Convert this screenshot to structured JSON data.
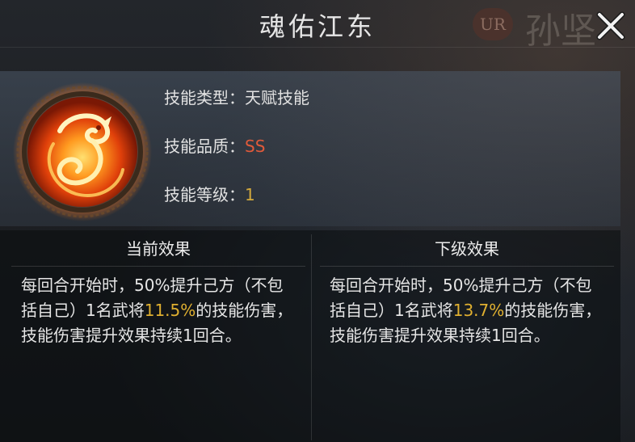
{
  "background": {
    "badge": "UR",
    "name": "孙坚"
  },
  "header": {
    "title": "魂佑江东"
  },
  "skill": {
    "icon": "dragon-emblem-icon",
    "type_label": "技能类型：",
    "type_value": "天赋技能",
    "quality_label": "技能品质：",
    "quality_value": "SS",
    "level_label": "技能等级：",
    "level_value": "1"
  },
  "current_effect": {
    "header": "当前效果",
    "text_before": "每回合开始时，50%提升己方（不包括自己）1名武将",
    "value": "11.5%",
    "text_after": "的技能伤害，技能伤害提升效果持续1回合。"
  },
  "next_effect": {
    "header": "下级效果",
    "text_before": "每回合开始时，50%提升己方（不包括自己）1名武将",
    "value": "13.7%",
    "text_after": "的技能伤害，技能伤害提升效果持续1回合。"
  },
  "colors": {
    "quality": "#e05a3a",
    "level": "#d4aa3c",
    "highlight": "#e0b030"
  }
}
